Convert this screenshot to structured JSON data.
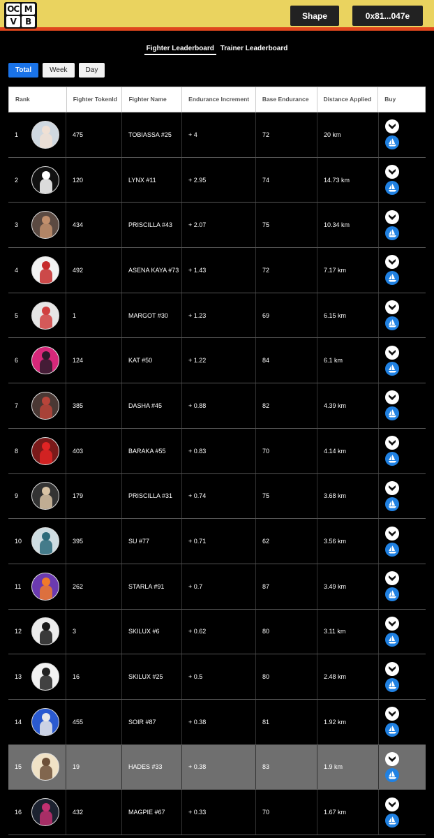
{
  "header": {
    "logo_letters": [
      "OC",
      "M",
      "V",
      "B"
    ],
    "shape_label": "Shape",
    "wallet_label": "0x81...047e",
    "colors": {
      "bar": "#ead35f",
      "stripe": "#e0461d"
    }
  },
  "leaderboard_tabs": [
    {
      "label": "Fighter Leaderboard",
      "active": true
    },
    {
      "label": "Trainer Leaderboard",
      "active": false
    }
  ],
  "range_tabs": [
    {
      "label": "Total",
      "active": true
    },
    {
      "label": "Week",
      "active": false
    },
    {
      "label": "Day",
      "active": false
    }
  ],
  "table": {
    "headers": {
      "rank": "Rank",
      "token": "Fighter TokenId",
      "name": "Fighter Name",
      "endurance": "Endurance Increment",
      "base": "Base Endurance",
      "distance": "Distance Applied",
      "buy": "Buy"
    },
    "buy_icons": {
      "first": "blur-marketplace-icon",
      "second": "opensea-sailboat-icon"
    },
    "rows": [
      {
        "rank": "1",
        "token": "475",
        "name": "TOBIASSA #25",
        "endurance": "+ 4",
        "base": "72",
        "distance": "20 km",
        "avatar_bg": "#cfd8e0",
        "avatar_fg": "#f0e0d4"
      },
      {
        "rank": "2",
        "token": "120",
        "name": "LYNX #11",
        "endurance": "+ 2.95",
        "base": "74",
        "distance": "14.73 km",
        "avatar_bg": "#111111",
        "avatar_fg": "#ffffff"
      },
      {
        "rank": "3",
        "token": "434",
        "name": "PRISCILLA #43",
        "endurance": "+ 2.07",
        "base": "75",
        "distance": "10.34 km",
        "avatar_bg": "#5b4a42",
        "avatar_fg": "#c28f6c"
      },
      {
        "rank": "4",
        "token": "492",
        "name": "ASENA KAYA #73",
        "endurance": "+ 1.43",
        "base": "72",
        "distance": "7.17 km",
        "avatar_bg": "#f2f2f2",
        "avatar_fg": "#c62b2b"
      },
      {
        "rank": "5",
        "token": "1",
        "name": "MARGOT #30",
        "endurance": "+ 1.23",
        "base": "69",
        "distance": "6.15 km",
        "avatar_bg": "#e6e6e6",
        "avatar_fg": "#d04040"
      },
      {
        "rank": "6",
        "token": "124",
        "name": "KAT #50",
        "endurance": "+ 1.22",
        "base": "84",
        "distance": "6.1 km",
        "avatar_bg": "#d6287a",
        "avatar_fg": "#2a1a2a"
      },
      {
        "rank": "7",
        "token": "385",
        "name": "DASHA #45",
        "endurance": "+ 0.88",
        "base": "82",
        "distance": "4.39 km",
        "avatar_bg": "#4a3834",
        "avatar_fg": "#b8443a"
      },
      {
        "rank": "8",
        "token": "403",
        "name": "BARAKA #55",
        "endurance": "+ 0.83",
        "base": "70",
        "distance": "4.14 km",
        "avatar_bg": "#7a1a1a",
        "avatar_fg": "#e02424"
      },
      {
        "rank": "9",
        "token": "179",
        "name": "PRISCILLA #31",
        "endurance": "+ 0.74",
        "base": "75",
        "distance": "3.68 km",
        "avatar_bg": "#333333",
        "avatar_fg": "#d9c3a4"
      },
      {
        "rank": "10",
        "token": "395",
        "name": "SU #77",
        "endurance": "+ 0.71",
        "base": "62",
        "distance": "3.56 km",
        "avatar_bg": "#cfdde2",
        "avatar_fg": "#2c6a7a"
      },
      {
        "rank": "11",
        "token": "262",
        "name": "STARLA #91",
        "endurance": "+ 0.7",
        "base": "87",
        "distance": "3.49 km",
        "avatar_bg": "#6b3ab0",
        "avatar_fg": "#f07a2a"
      },
      {
        "rank": "12",
        "token": "3",
        "name": "SKILUX #6",
        "endurance": "+ 0.62",
        "base": "80",
        "distance": "3.11 km",
        "avatar_bg": "#ececec",
        "avatar_fg": "#1a1a1a"
      },
      {
        "rank": "13",
        "token": "16",
        "name": "SKILUX #25",
        "endurance": "+ 0.5",
        "base": "80",
        "distance": "2.48 km",
        "avatar_bg": "#f2f2f2",
        "avatar_fg": "#222222"
      },
      {
        "rank": "14",
        "token": "455",
        "name": "SOIR #87",
        "endurance": "+ 0.38",
        "base": "81",
        "distance": "1.92 km",
        "avatar_bg": "#2a5ad0",
        "avatar_fg": "#e8e8e8"
      },
      {
        "rank": "15",
        "token": "19",
        "name": "HADES #33",
        "endurance": "+ 0.38",
        "base": "83",
        "distance": "1.9 km",
        "avatar_bg": "#f0e2c6",
        "avatar_fg": "#6d5038",
        "highlight": true
      },
      {
        "rank": "16",
        "token": "432",
        "name": "MAGPIE #67",
        "endurance": "+ 0.33",
        "base": "70",
        "distance": "1.67 km",
        "avatar_bg": "#1c2230",
        "avatar_fg": "#c03070"
      }
    ]
  }
}
